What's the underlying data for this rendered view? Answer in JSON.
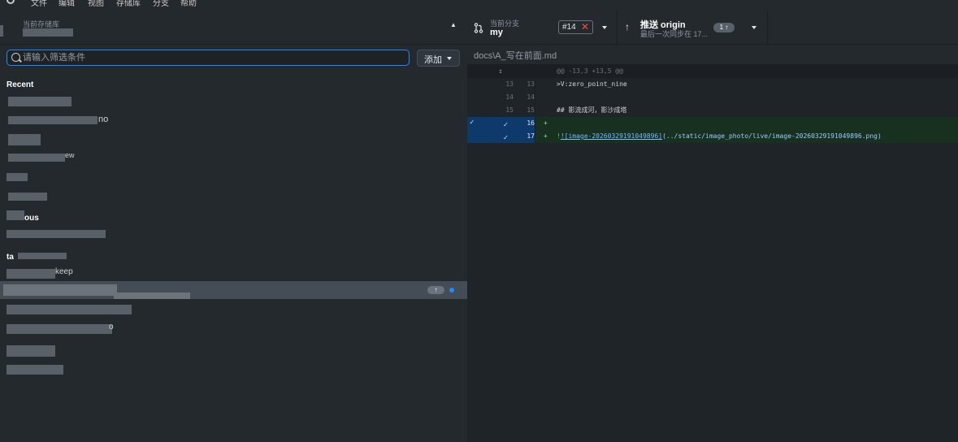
{
  "menubar": {
    "items": [
      "文件",
      "编辑",
      "视图",
      "存储库",
      "分支",
      "帮助"
    ]
  },
  "repo_header": {
    "label": "当前存储库"
  },
  "filter": {
    "placeholder": "请输入筛选条件",
    "add_label": "添加"
  },
  "groups": {
    "recent": "Recent",
    "other": "ous",
    "third": "ta"
  },
  "repos": {
    "item2_suffix": "no",
    "item4_suffix": "ew",
    "selected_suffix": "",
    "after_sel": "keep",
    "last_suffix": "o",
    "ahead_badge": "↑"
  },
  "toolbar": {
    "branch_sub": "当前分支",
    "branch_name": "my",
    "pr_number": "#14",
    "push_title": "推送 origin",
    "push_sub": "最后一次同步在 17...",
    "push_count": "1 ↑"
  },
  "diff": {
    "file_path": "docs\\A_写在前面.md",
    "hunk_header": "@@ -13,3 +13,5 @@",
    "lines": [
      {
        "old": "13",
        "new": "13",
        "sign": "",
        "text": ">V:zero_point_nine"
      },
      {
        "old": "14",
        "new": "14",
        "sign": "",
        "text": ""
      },
      {
        "old": "15",
        "new": "15",
        "sign": "",
        "text": "## 影流成河，影沙成塔"
      },
      {
        "old": "",
        "new": "16",
        "sign": "+",
        "text": ""
      },
      {
        "old": "",
        "new": "17",
        "sign": "+",
        "text_link": "![image-20260329191049896]",
        "text_path": "(../static/image_photo/live/image-20260329191049896.png)"
      }
    ]
  },
  "colors": {
    "accent": "#2188ff",
    "bg": "#24292e",
    "add_bg": "#17301f"
  }
}
